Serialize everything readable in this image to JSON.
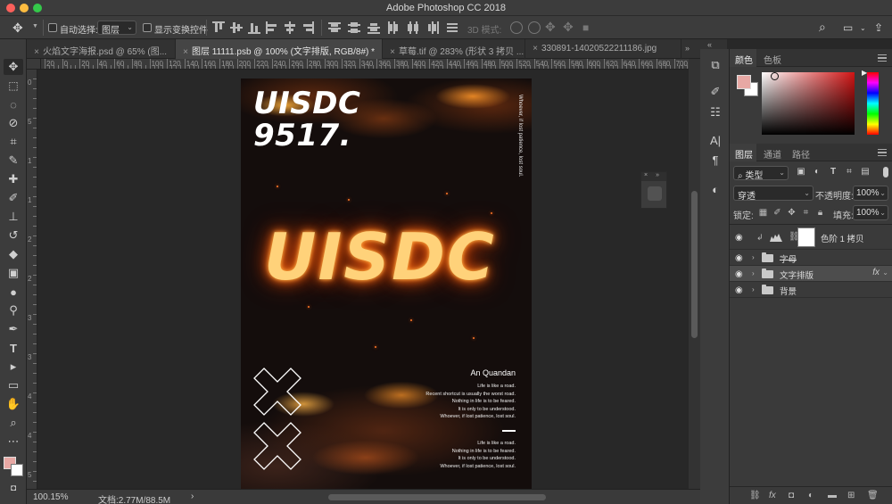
{
  "app": {
    "title": "Adobe Photoshop CC 2018"
  },
  "options_bar": {
    "auto_select_label": "自动选择:",
    "auto_select_target": "图层",
    "show_transform_label": "显示变换控件",
    "mode_3d_label": "3D 模式:"
  },
  "tabs": [
    {
      "label": "火焰文字海报.psd @ 65% (图...",
      "active": false
    },
    {
      "label": "图层 11111.psb @ 100% (文字排版, RGB/8#) *",
      "active": true
    },
    {
      "label": "草莓.tif @ 283% (形状 3 拷贝 ...",
      "active": false
    },
    {
      "label": "330891-14020522211186.jpg",
      "active": false
    }
  ],
  "rulers": {
    "top": [
      "20",
      "0",
      "20",
      "40",
      "60",
      "80",
      "100",
      "120",
      "140",
      "160",
      "180",
      "200",
      "220",
      "240",
      "260",
      "280",
      "300",
      "320",
      "340",
      "360",
      "380",
      "400",
      "420",
      "440",
      "460",
      "480",
      "500",
      "520",
      "540",
      "560",
      "580",
      "600",
      "620",
      "640",
      "660",
      "680",
      "700",
      "720",
      "740"
    ],
    "left": [
      "0",
      "5",
      "1",
      "1",
      "2",
      "2",
      "3",
      "3",
      "4",
      "4",
      "5"
    ]
  },
  "poster": {
    "title_line1": "UISDC",
    "title_line2": "9517.",
    "vertical_text": "Whoever, if lost patience, lost soul.",
    "fire_word": "UISDC",
    "author": "An Quandan",
    "quote1": [
      "Life is like a road.",
      "Recent shortcut is usually the worst road.",
      "Nothing in life is to be feared.",
      "It is only to be understood.",
      "Whoever, if lost patience, lost soul."
    ],
    "quote2": [
      "Life is like a road.",
      "Nothing in life is to be feared.",
      "It is only to be understood.",
      "Whoever, if lost patience, lost soul."
    ]
  },
  "status": {
    "zoom": "100.15%",
    "doc_info": "文档:2.77M/88.5M"
  },
  "color_panel": {
    "tabs": [
      "颜色",
      "色板"
    ],
    "foreground": "#e7a8a4",
    "background": "#ffffff"
  },
  "layers_panel": {
    "tabs": [
      "图层",
      "通道",
      "路径"
    ],
    "filter_kind": "类型",
    "blend_mode": "穿透",
    "opacity_label": "不透明度:",
    "opacity": "100%",
    "lock_label": "锁定:",
    "fill_label": "填充:",
    "fill": "100%",
    "layers": [
      {
        "name": "色阶 1 拷贝",
        "type": "adjustment",
        "visible": true
      },
      {
        "name": "字母",
        "type": "group",
        "visible": true,
        "strike": true
      },
      {
        "name": "文字排版",
        "type": "group",
        "visible": true,
        "selected": true,
        "fx": "fx"
      },
      {
        "name": "背景",
        "type": "group",
        "visible": true
      }
    ]
  }
}
